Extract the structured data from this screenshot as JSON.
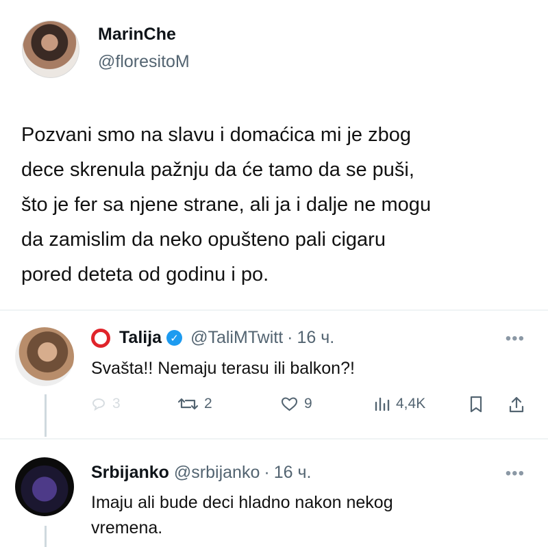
{
  "main_tweet": {
    "name": "MarinChe",
    "handle": "@floresitoM",
    "text": "Pozvani smo na slavu i domaćica mi je zbog\ndece skrenula pažnju da će tamo da se puši,\nšto je fer sa njene strane, ali ja i dalje ne mogu\nda zamislim da neko opušteno pali cigaru\npored deteta od godinu i po."
  },
  "replies": [
    {
      "name": "Talija",
      "handle": "@TaliMTwitt",
      "separator": "·",
      "time": "16 ч.",
      "text": "Svašta!! Nemaju terasu ili balkon?!",
      "actions": {
        "reply_count": "3",
        "retweet_count": "2",
        "like_count": "9",
        "views": "4,4K"
      }
    },
    {
      "name": "Srbijanko",
      "handle": "@srbijanko",
      "separator": "·",
      "time": "16 ч.",
      "text": "Imaju ali bude deci hladno nakon nekog\nvremena."
    }
  ],
  "icons": {
    "more": "more-icon",
    "reply": "reply-icon",
    "retweet": "retweet-icon",
    "like": "heart-icon",
    "views": "views-icon",
    "bookmark": "bookmark-icon",
    "share": "share-icon"
  },
  "colors": {
    "verified": "#1d9bf0",
    "accent_red": "#e0242a",
    "muted_text": "#536471"
  }
}
